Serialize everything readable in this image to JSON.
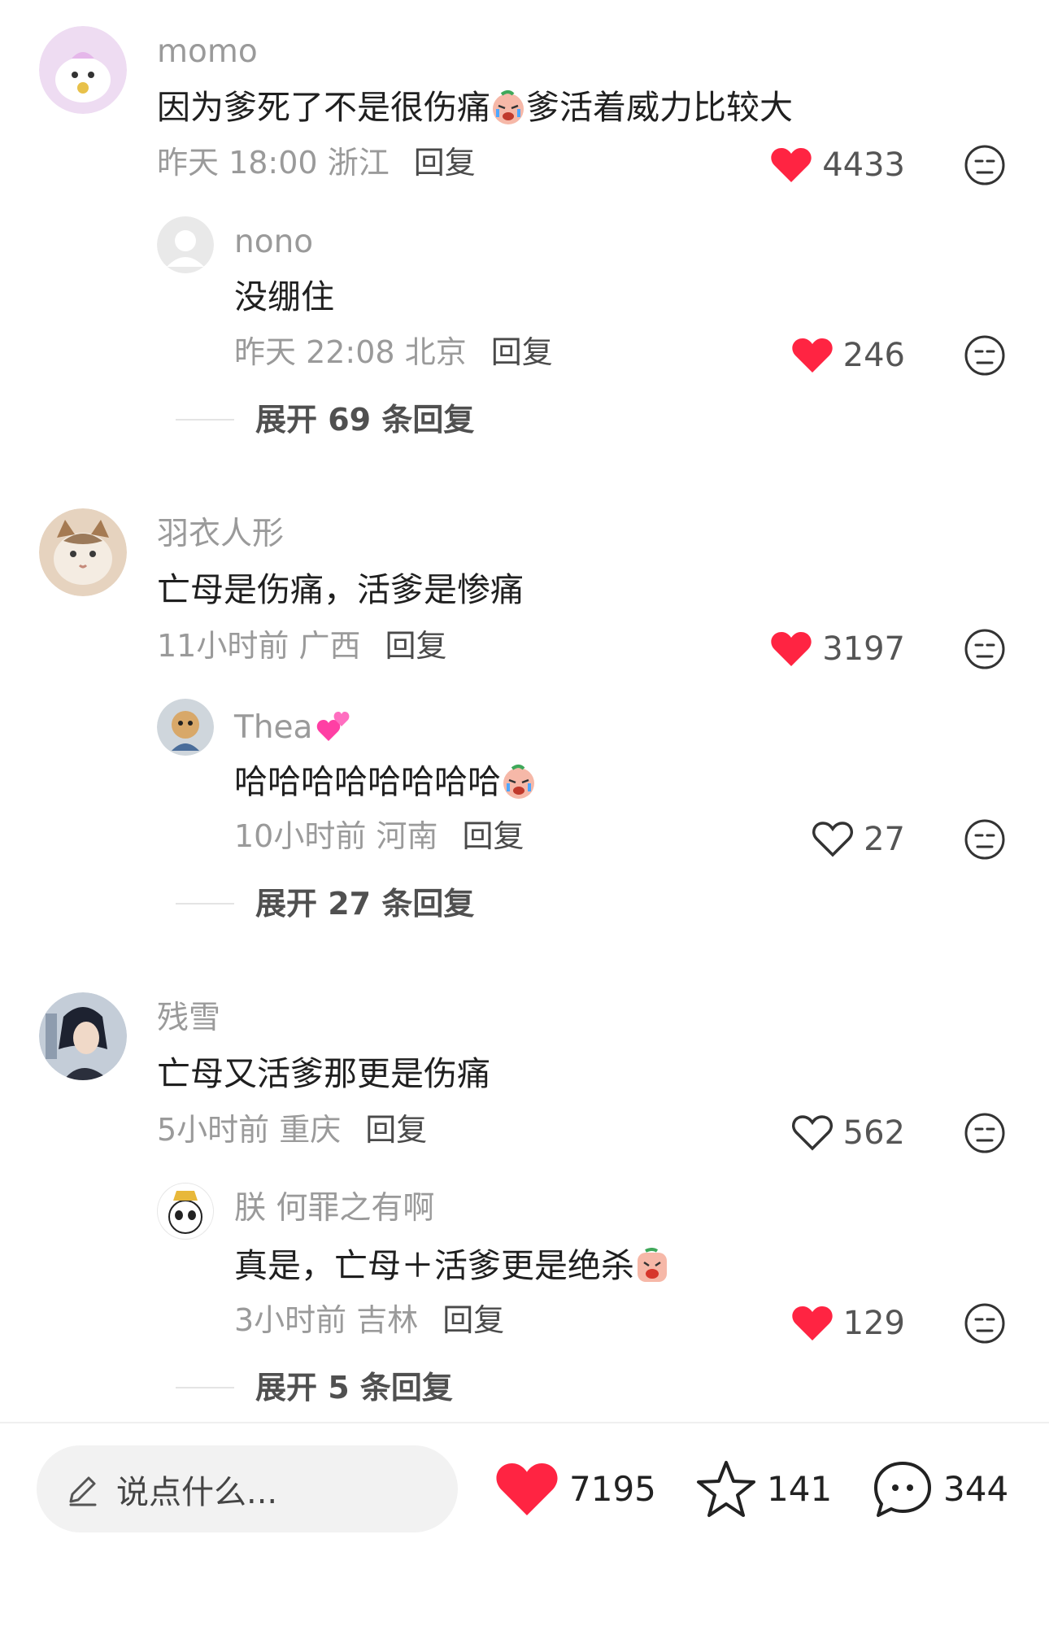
{
  "comments": [
    {
      "user": "momo",
      "text_before": "因为爹死了不是很伤痛",
      "text_after": "爹活着威力比较大",
      "time": "昨天 18:00",
      "location": "浙江",
      "reply_label": "回复",
      "likes": "4433",
      "liked": true,
      "sub": {
        "user": "nono",
        "text": "没绷住",
        "time": "昨天 22:08",
        "location": "北京",
        "reply_label": "回复",
        "likes": "246",
        "liked": true
      },
      "expand": "展开 69 条回复"
    },
    {
      "user": "羽衣人形",
      "text": "亡母是伤痛，活爹是惨痛",
      "time": "11小时前",
      "location": "广西",
      "reply_label": "回复",
      "likes": "3197",
      "liked": true,
      "sub": {
        "user": "Thea",
        "text": "哈哈哈哈哈哈哈哈",
        "time": "10小时前",
        "location": "河南",
        "reply_label": "回复",
        "likes": "27",
        "liked": false
      },
      "expand": "展开 27 条回复"
    },
    {
      "user": "残雪",
      "text": "亡母又活爹那更是伤痛",
      "time": "5小时前",
      "location": "重庆",
      "reply_label": "回复",
      "likes": "562",
      "liked": false,
      "sub": {
        "user": "朕 何罪之有啊",
        "text": "真是，亡母＋活爹更是绝杀",
        "time": "3小时前",
        "location": "吉林",
        "reply_label": "回复",
        "likes": "129",
        "liked": true
      },
      "expand": "展开 5 条回复"
    }
  ],
  "bottom_bar": {
    "input_placeholder": "说点什么...",
    "likes": "7195",
    "favorites": "141",
    "comments": "344"
  },
  "colors": {
    "like_red": "#ff2442",
    "muted_text": "#9a9a9a"
  },
  "icons": [
    "heart-icon",
    "heart-outline-icon",
    "dislike-face-icon",
    "pencil-icon",
    "star-icon",
    "comment-bubble-icon",
    "crying-emoji",
    "sparkling-heart-emoji"
  ]
}
